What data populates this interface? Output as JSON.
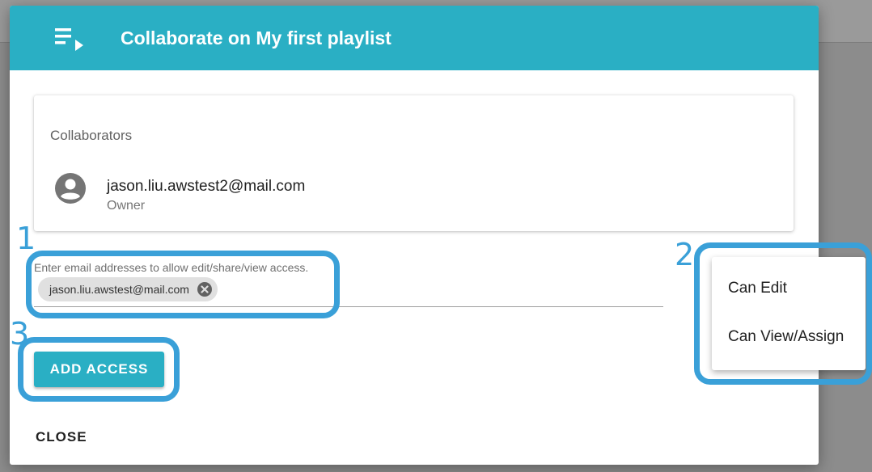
{
  "dialog": {
    "title": "Collaborate on My first playlist",
    "header_icon": "playlist-play-icon",
    "header_color": "#2aafc4"
  },
  "collaborators": {
    "heading": "Collaborators",
    "items": [
      {
        "email": "jason.liu.awstest2@mail.com",
        "role": "Owner",
        "icon": "account-circle-icon"
      }
    ]
  },
  "email_input": {
    "label": "Enter email addresses to allow edit/share/view access.",
    "chips": [
      {
        "text": "jason.liu.awstest@mail.com",
        "icon": "cancel-icon"
      }
    ]
  },
  "permission_menu": {
    "options": [
      "Can Edit",
      "Can View/Assign"
    ]
  },
  "actions": {
    "add_label": "ADD ACCESS",
    "close_label": "CLOSE"
  },
  "annotations": {
    "color": "#3aa0d8",
    "labels": [
      "1",
      "2",
      "3"
    ]
  }
}
